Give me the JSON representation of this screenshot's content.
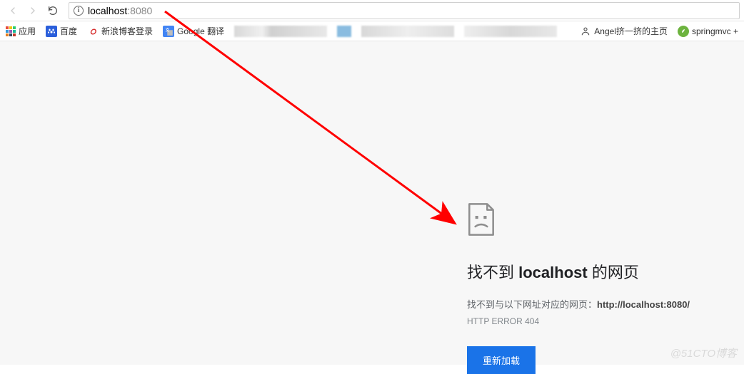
{
  "toolbar": {
    "url_host": "localhost",
    "url_port": ":8080"
  },
  "bookmarks": {
    "apps_label": "应用",
    "items": [
      {
        "label": "百度"
      },
      {
        "label": "新浪博客登录"
      },
      {
        "label": "Google 翻译"
      }
    ],
    "right_items": [
      {
        "label": "Angel挤一挤的主页"
      },
      {
        "label": "springmvc +"
      }
    ]
  },
  "error": {
    "heading_prefix": "找不到 ",
    "heading_host": "localhost",
    "heading_suffix": " 的网页",
    "desc_prefix": "找不到与以下网址对应的网页：",
    "desc_url": "http://localhost:8080/",
    "code": "HTTP ERROR 404",
    "reload_label": "重新加载"
  },
  "watermark": "@51CTO博客"
}
